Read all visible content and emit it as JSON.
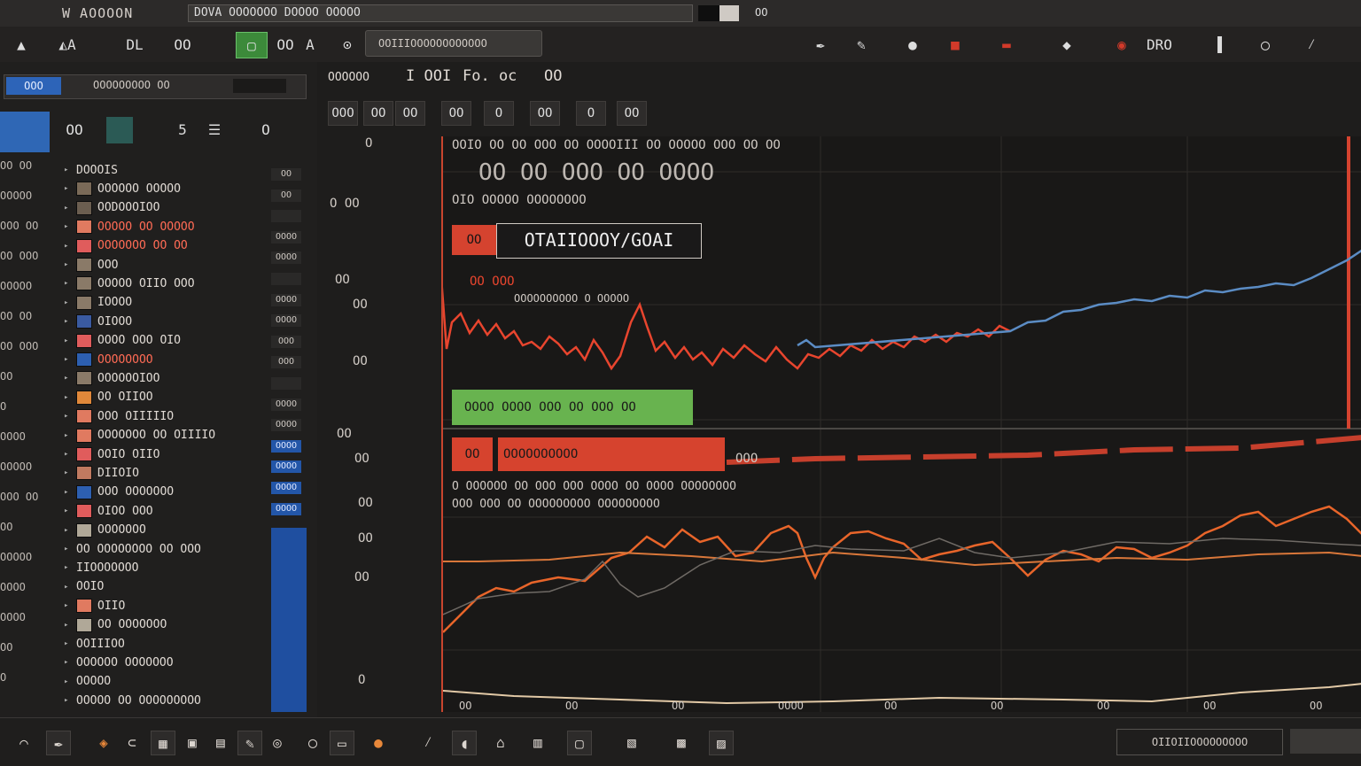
{
  "titlebar": {
    "app_title": "W AOOOON",
    "document": "DOVA OOOOOOO DOOOO OOOOO",
    "counter": "OO"
  },
  "toolbar": {
    "left_tools": [
      {
        "icon": "shape-icon"
      },
      {
        "icon": "triangle-icon",
        "label": "A"
      },
      {
        "icon": "brush-icon",
        "label": "DL"
      },
      {
        "icon": "path-icon",
        "label": "OO"
      },
      {
        "icon": "layer-icon",
        "active": true
      },
      {
        "icon": "pin-icon",
        "label": "OO"
      },
      {
        "icon": "text-icon",
        "label": "A"
      },
      {
        "icon": "target-icon",
        "label": "O"
      }
    ],
    "search_text": "OOIIIOOOOOOOOOOOO",
    "right_tools": [
      {
        "icon": "pen-icon"
      },
      {
        "icon": "brush-icon"
      },
      {
        "icon": "drop-icon"
      },
      {
        "icon": "box-icon",
        "red": true
      },
      {
        "icon": "flag-icon",
        "red": true
      },
      {
        "icon": "cursor-icon"
      },
      {
        "icon": "erase-icon",
        "red": true
      },
      {
        "icon": "grid-icon",
        "label": "DRO"
      },
      {
        "icon": "split-icon"
      },
      {
        "icon": "circle-icon"
      },
      {
        "icon": "pencil-icon"
      }
    ]
  },
  "left_panel": {
    "tab": "OOO",
    "header": "OOOOOOOOO OO",
    "icon_row": [
      "OO",
      "5",
      "OO",
      "O"
    ],
    "layers": [
      {
        "label": "DOOOIS",
        "swatch": "",
        "hl": false
      },
      {
        "label": "OOOOOO OOOOO",
        "swatch": "#7a6a58",
        "hl": false
      },
      {
        "label": "OODOOOIOO",
        "swatch": "#6b5e50",
        "hl": false
      },
      {
        "label": "OOOOO OO OOOOO",
        "swatch": "#e07a60",
        "hl": true
      },
      {
        "label": "OOOOOOO OO OO",
        "swatch": "#e05c5c",
        "hl": true
      },
      {
        "label": "OOO",
        "swatch": "#8a7a68",
        "hl": false
      },
      {
        "label": "OOOOO OIIO OOO",
        "swatch": "#8a7a68",
        "hl": false
      },
      {
        "label": "IOOOO",
        "swatch": "#8a7a68",
        "hl": false
      },
      {
        "label": "OIOOO",
        "swatch": "#3a5aa0",
        "hl": false
      },
      {
        "label": "OOOO OOO OIO",
        "swatch": "#e05c5c",
        "hl": false
      },
      {
        "label": "OOOOOOOO",
        "swatch": "#2d5fb0",
        "hl": true
      },
      {
        "label": "OOOOOOIOO",
        "swatch": "#8a7a68",
        "hl": false
      },
      {
        "label": "OO OIIOO",
        "swatch": "#e0883a",
        "hl": false
      },
      {
        "label": "OOO OIIIIIO",
        "swatch": "#e07a60",
        "hl": false
      },
      {
        "label": "OOOOOOO OO OIIIIO",
        "swatch": "#e07a60",
        "hl": false
      },
      {
        "label": "OOIO OIIO",
        "swatch": "#e05c5c",
        "hl": false
      },
      {
        "label": "DIIOIO",
        "swatch": "#c07a60",
        "hl": false
      },
      {
        "label": "OOO OOOOOOO",
        "swatch": "#2d5fb0",
        "hl": false
      },
      {
        "label": "OIOO OOO",
        "swatch": "#e05c5c",
        "hl": false
      },
      {
        "label": "OOOOOOO",
        "swatch": "#b0a898",
        "hl": false
      },
      {
        "label": "OO OOOOOOOO OO OOO",
        "swatch": "",
        "hl": false
      },
      {
        "label": "IIOOOOOOO",
        "swatch": "",
        "hl": false
      },
      {
        "label": "OOIO",
        "swatch": "",
        "hl": false
      },
      {
        "label": "OIIO",
        "swatch": "#e07a60",
        "hl": false
      },
      {
        "label": "OO OOOOOOO",
        "swatch": "#b0a898",
        "hl": false
      },
      {
        "label": "OOIIIOO",
        "swatch": "",
        "hl": false
      },
      {
        "label": "OOOOOO OOOOOOO",
        "swatch": "",
        "hl": false
      },
      {
        "label": "OOOOO",
        "swatch": "",
        "hl": false
      },
      {
        "label": "OOOOO OO OOOOOOOOO",
        "swatch": "",
        "hl": false
      }
    ],
    "left_cut": [
      "OO OO",
      "OOOOO",
      "OOO OO",
      "OO OOO",
      "OOOOO",
      "OO OO",
      "OO OOO",
      "OO",
      "O",
      "OOOO",
      "OOOOO",
      "OOO OO",
      "OO",
      "OOOOO",
      "OOOO",
      "OOOO",
      "OO",
      "O"
    ],
    "right_cut": [
      "OO",
      "OO",
      "",
      "OOOO",
      "OOOO",
      "",
      "OOOO",
      "OOOO",
      "OOO",
      "OOO",
      "",
      "OOOO",
      "OOOO",
      "OOOO",
      "OOOO",
      "OOOO",
      "OOOO"
    ]
  },
  "canvas": {
    "tabs": [
      "OOOOOO",
      "I OOI",
      "Fo. oc",
      "OO"
    ],
    "tool_tabs": [
      "OOO",
      "OO",
      "OO",
      "OO",
      "O",
      "OO",
      "O",
      "OO"
    ],
    "plot_header": "OOIO OO OO OOO OO OOOOIII OO OOOOO OOO OO OO",
    "annotation_top": "OO OO OOO OO OOOO",
    "annotation_sub": "OIO OOOOO OOOOOOOO",
    "badge_left": "OO",
    "label_box": "OTAIIOOOY/GOAI",
    "badge_tag": "OO OOO",
    "status_line": "OOOOOOOOOO O OOOOO",
    "y_labels": [
      "O",
      "O OO",
      "OO",
      "OO",
      "OO",
      "OO",
      "OO",
      "OO",
      "OO",
      "OO",
      "O"
    ],
    "green_bar": "OOOO OOOO OOO OO OOO OO",
    "red_bar_label": "OO",
    "red_bar_text": "OOOOOOOOOO",
    "lower_caption_a": "O OOOOOO OO OOO OOO OOOO OO OOOO OOOOOOOO",
    "lower_caption_b": "OOO OOO OO OOOOOOOOO OOOOOOOOO",
    "red_bar_right": "OOO",
    "x_ticks": [
      "OO",
      "OO",
      "OO",
      "OOOO",
      "OO",
      "OO",
      "OO",
      "OO",
      "OO"
    ]
  },
  "statusbar": {
    "icons": [
      "link-icon",
      "pen-icon",
      "layers-icon",
      "tag-icon",
      "grid-icon",
      "square-icon",
      "image-icon",
      "brush-icon",
      "circle-icon",
      "ring-icon",
      "page-icon",
      "droplet-icon",
      "pencil-icon",
      "bubble-icon",
      "node-icon",
      "split-icon",
      "frame-icon",
      "group-icon",
      "box-icon",
      "box2-icon"
    ],
    "status_text": "OIIOIIOOOOOOOOO"
  },
  "colors": {
    "accent_red": "#d5432f",
    "accent_green": "#68b34f",
    "accent_blue": "#2d64b8",
    "series_blue": "#5b8cc4",
    "series_orange": "#e8652a"
  }
}
